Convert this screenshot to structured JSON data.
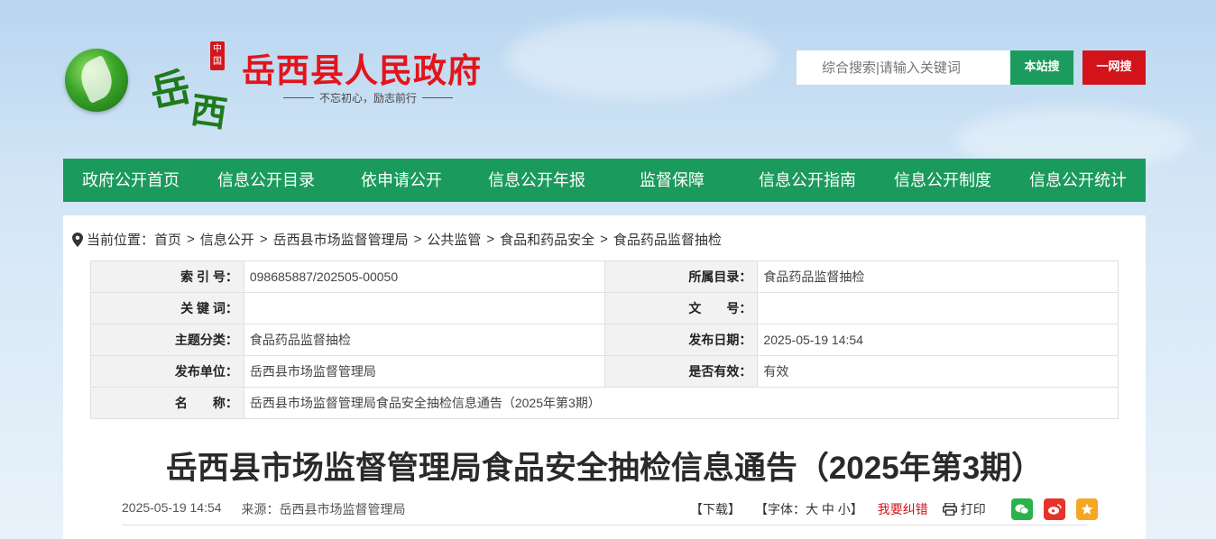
{
  "header": {
    "site_title": "岳西县人民政府",
    "slogan": "不忘初心，励志前行",
    "calligraphy_1": "岳",
    "calligraphy_2": "西",
    "seal_text": "中国",
    "search_placeholder": "综合搜索|请输入关键词",
    "btn_local": "本站搜",
    "btn_all": "一网搜"
  },
  "nav": {
    "items": [
      "政府公开首页",
      "信息公开目录",
      "依申请公开",
      "信息公开年报",
      "监督保障",
      "信息公开指南",
      "信息公开制度",
      "信息公开统计"
    ]
  },
  "breadcrumb": {
    "prefix": "当前位置：",
    "items": [
      "首页",
      "信息公开",
      "岳西县市场监督管理局",
      "公共监管",
      "食品和药品安全",
      "食品药品监督抽检"
    ],
    "separator": ">"
  },
  "meta": {
    "index_label": "索 引 号：",
    "index_value": "098685887/202505-00050",
    "catalog_label": "所属目录：",
    "catalog_value": "食品药品监督抽检",
    "keywords_label": "关 键 词：",
    "keywords_value": "",
    "doc_no_label": "文　　号：",
    "doc_no_value": "",
    "topic_label": "主题分类：",
    "topic_value": "食品药品监督抽检",
    "date_label": "发布日期：",
    "date_value": "2025-05-19 14:54",
    "publisher_label": "发布单位：",
    "publisher_value": "岳西县市场监督管理局",
    "valid_label": "是否有效：",
    "valid_value": "有效",
    "name_label": "名　　称：",
    "name_value": "岳西县市场监督管理局食品安全抽检信息通告（2025年第3期）"
  },
  "article": {
    "title": "岳西县市场监督管理局食品安全抽检信息通告（2025年第3期）",
    "date": "2025-05-19 14:54",
    "source": "来源：岳西县市场监督管理局"
  },
  "tools": {
    "download": "【下载】",
    "font_size": "【字体：大 中 小】",
    "correction": "我要纠错",
    "print": "打印",
    "share_icons": [
      "wechat-icon",
      "weibo-icon",
      "favorite-icon"
    ]
  },
  "colors": {
    "green": "#1b9a5d",
    "red": "#d2141a"
  }
}
